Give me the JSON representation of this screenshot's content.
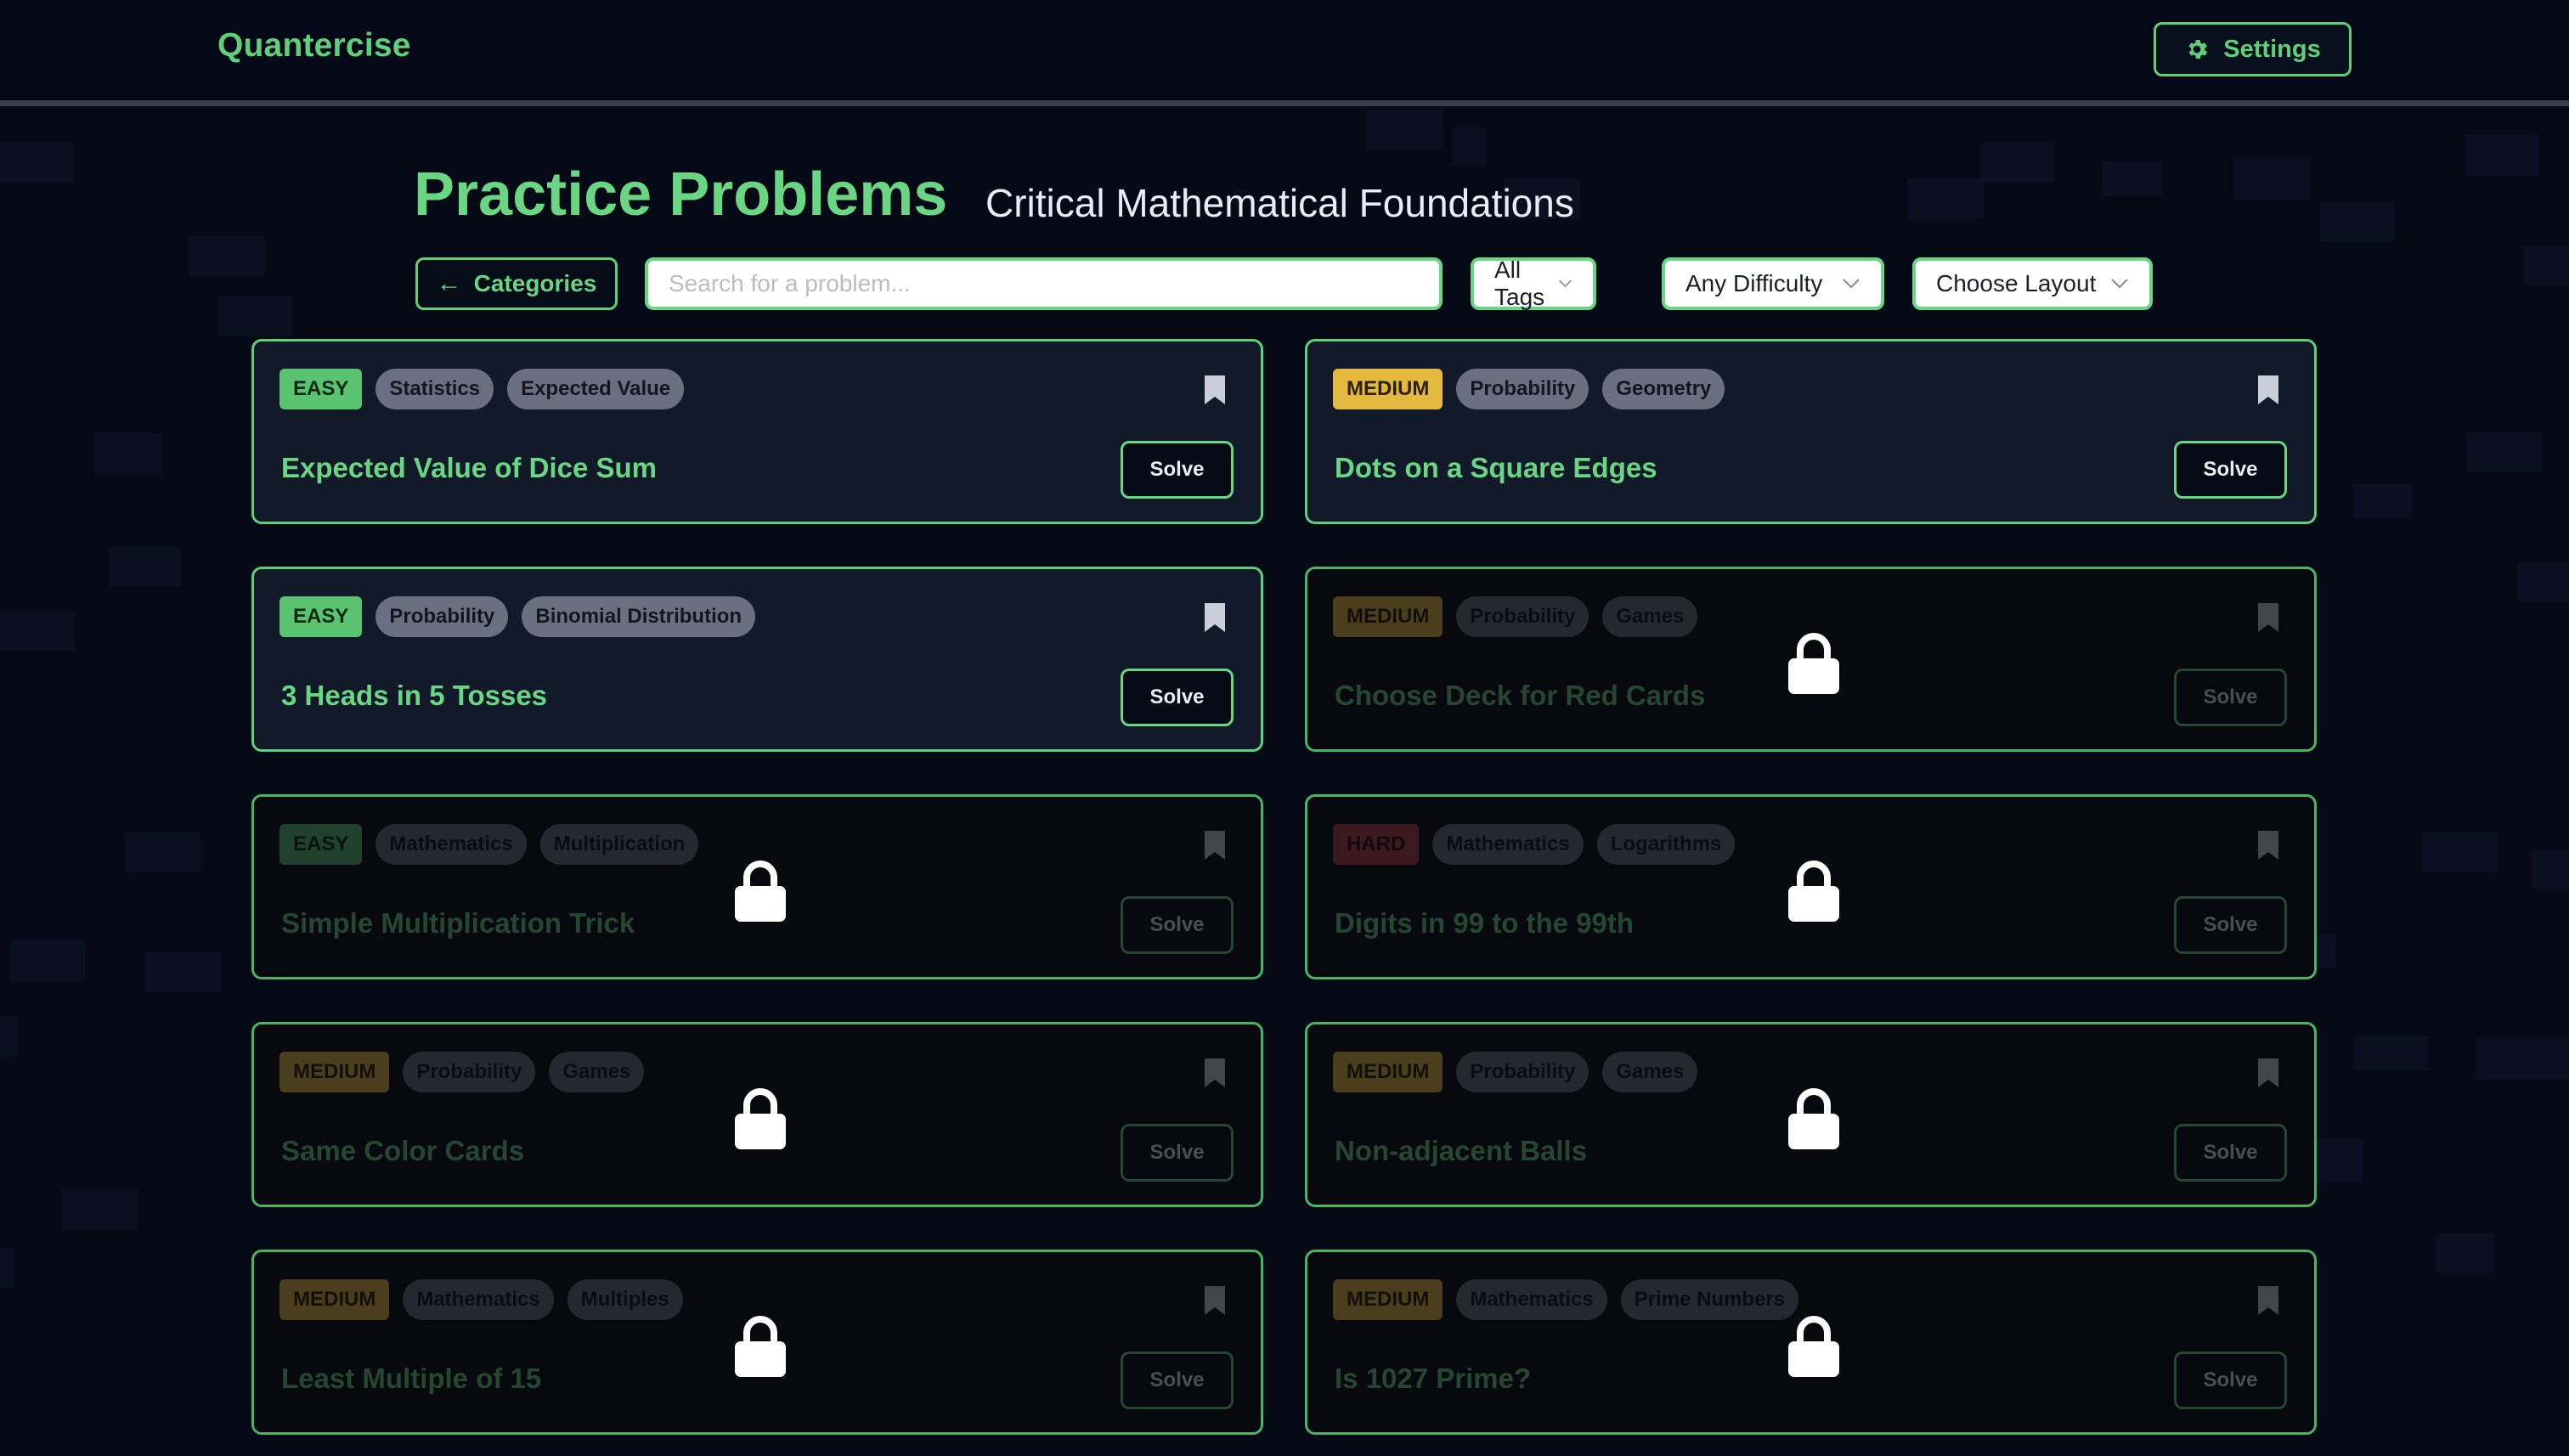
{
  "app": {
    "brand": "Quantercise"
  },
  "header": {
    "settings_label": "Settings",
    "settings_icon": "gear-icon"
  },
  "page": {
    "title": "Practice Problems",
    "subtitle": "Critical Mathematical Foundations"
  },
  "controls": {
    "categories_label": "Categories",
    "search_placeholder": "Search for a problem...",
    "tags_select": "All Tags",
    "difficulty_select": "Any Difficulty",
    "layout_select": "Choose Layout"
  },
  "colors": {
    "accent": "#5fd07a",
    "easy": "#59c372",
    "medium": "#e3b93f",
    "hard": "#b33f44",
    "background": "#060a17"
  },
  "solve_label": "Solve",
  "problems": [
    {
      "difficulty": "EASY",
      "level": "easy",
      "tags": [
        "Statistics",
        "Expected Value"
      ],
      "title": "Expected Value of Dice Sum",
      "locked": false
    },
    {
      "difficulty": "MEDIUM",
      "level": "medium",
      "tags": [
        "Probability",
        "Geometry"
      ],
      "title": "Dots on a Square Edges",
      "locked": false
    },
    {
      "difficulty": "EASY",
      "level": "easy",
      "tags": [
        "Probability",
        "Binomial Distribution"
      ],
      "title": "3 Heads in 5 Tosses",
      "locked": false
    },
    {
      "difficulty": "MEDIUM",
      "level": "medium",
      "tags": [
        "Probability",
        "Games"
      ],
      "title": "Choose Deck for Red Cards",
      "locked": true
    },
    {
      "difficulty": "EASY",
      "level": "easy",
      "tags": [
        "Mathematics",
        "Multiplication"
      ],
      "title": "Simple Multiplication Trick",
      "locked": true
    },
    {
      "difficulty": "HARD",
      "level": "hard",
      "tags": [
        "Mathematics",
        "Logarithms"
      ],
      "title": "Digits in 99 to the 99th",
      "locked": true
    },
    {
      "difficulty": "MEDIUM",
      "level": "medium",
      "tags": [
        "Probability",
        "Games"
      ],
      "title": "Same Color Cards",
      "locked": true
    },
    {
      "difficulty": "MEDIUM",
      "level": "medium",
      "tags": [
        "Probability",
        "Games"
      ],
      "title": "Non-adjacent Balls",
      "locked": true
    },
    {
      "difficulty": "MEDIUM",
      "level": "medium",
      "tags": [
        "Mathematics",
        "Multiples"
      ],
      "title": "Least Multiple of 15",
      "locked": true
    },
    {
      "difficulty": "MEDIUM",
      "level": "medium",
      "tags": [
        "Mathematics",
        "Prime Numbers"
      ],
      "title": "Is 1027 Prime?",
      "locked": true
    }
  ]
}
